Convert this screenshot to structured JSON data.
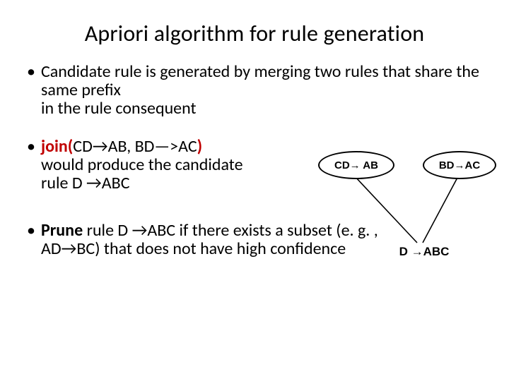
{
  "title": "Apriori algorithm for rule generation",
  "bullets": {
    "b1": "Candidate rule is generated by merging two rules that share the same prefix\nin the rule consequent",
    "b2": {
      "join_kw": "join(",
      "r1": "CD→AB",
      "comma": ", ",
      "r2": "BD—>AC",
      "close": ")",
      "tail1": "would produce the candidate",
      "tail2": "rule D →ABC"
    },
    "b3": {
      "prune_kw": "Prune",
      "tail": " rule D →ABC if there exists a subset (e. g. , AD→BC) that does not have high confidence"
    }
  },
  "diagram": {
    "left": "CD→ AB",
    "right": "BD→AC",
    "merged": "D →ABC"
  }
}
